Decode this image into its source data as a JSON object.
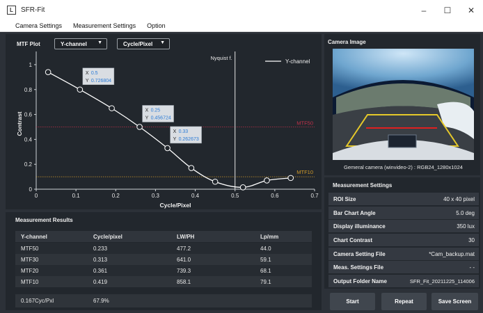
{
  "window": {
    "title": "SFR-Fit",
    "app_icon_glyph": "L",
    "controls": {
      "minimize": "–",
      "maximize": "☐",
      "close": "✕"
    }
  },
  "menu": [
    "Camera Settings",
    "Measurement Settings",
    "Option"
  ],
  "mtf_plot": {
    "title": "MTF Plot",
    "channel_dropdown": "Y-channel",
    "unit_dropdown": "Cycle/Pixel",
    "nyquist_label": "Nyquist f.",
    "mtf50_label": "MTF50",
    "mtf10_label": "MTF10",
    "tooltips": [
      {
        "x_label": "X",
        "x": "0.5",
        "y_label": "Y",
        "y": "0.726804"
      },
      {
        "x_label": "X",
        "x": "0.25",
        "y_label": "Y",
        "y": "0.456724"
      },
      {
        "x_label": "X",
        "x": "0.33",
        "y_label": "Y",
        "y": "0.262673"
      }
    ]
  },
  "chart_data": {
    "type": "line",
    "xlabel": "Cycle/Pixel",
    "ylabel": "Contrast",
    "xlim": [
      0,
      0.7
    ],
    "ylim": [
      0,
      1.05
    ],
    "x_ticks": [
      "0",
      "0.1",
      "0.2",
      "0.3",
      "0.4",
      "0.5",
      "0.6",
      "0.7"
    ],
    "y_ticks": [
      "0",
      "0.2",
      "0.4",
      "0.6",
      "0.8",
      "1"
    ],
    "legend": "top-right",
    "reference_lines": {
      "nyquist_x": 0.5,
      "mtf50_y": 0.5,
      "mtf10_y": 0.1
    },
    "series": [
      {
        "name": "Y-channel",
        "x": [
          0.03,
          0.11,
          0.19,
          0.26,
          0.33,
          0.39,
          0.45,
          0.52,
          0.58,
          0.64
        ],
        "y": [
          0.94,
          0.8,
          0.65,
          0.5,
          0.33,
          0.17,
          0.06,
          0.015,
          0.07,
          0.09
        ]
      }
    ]
  },
  "results": {
    "title": "Measurement Results",
    "headers": [
      "Y-channel",
      "Cycle/pixel",
      "LW/PH",
      "Lp/mm"
    ],
    "rows": [
      [
        "MTF50",
        "0.233",
        "477.2",
        "44.0"
      ],
      [
        "MTF30",
        "0.313",
        "641.0",
        "59.1"
      ],
      [
        "MTF20",
        "0.361",
        "739.3",
        "68.1"
      ],
      [
        "MTF10",
        "0.419",
        "858.1",
        "79.1"
      ]
    ],
    "summary_label": "0.167Cyc/Pxl",
    "summary_value": "67.9%"
  },
  "camera": {
    "title": "Camera Image",
    "caption": "Gemeral camera (winvideo-2) : RGB24_1280x1024"
  },
  "settings": {
    "title": "Measurement Settings",
    "rows": [
      {
        "key": "ROI Size",
        "value": "40 x 40 pixel"
      },
      {
        "key": "Bar Chart Angle",
        "value": "5.0 deg"
      },
      {
        "key": "Display illuminance",
        "value": "350 lux"
      },
      {
        "key": "Chart Contrast",
        "value": "30"
      },
      {
        "key": "Camera Setting File",
        "value": "*Cam_backup.mat"
      },
      {
        "key": "Meas. Settings File",
        "value": "- -"
      },
      {
        "key": "Output Folder Name",
        "value": "SFR_Fit_20211225_114006"
      }
    ]
  },
  "buttons": {
    "start": "Start",
    "repeat": "Repeat",
    "save": "Save Screen"
  },
  "colors": {
    "curve": "#ffffff",
    "mtf50_line": "#c0304a",
    "mtf10_line": "#d09a2a",
    "tooltip_value": "#2b7bd6",
    "panel_bg": "#22272d"
  }
}
